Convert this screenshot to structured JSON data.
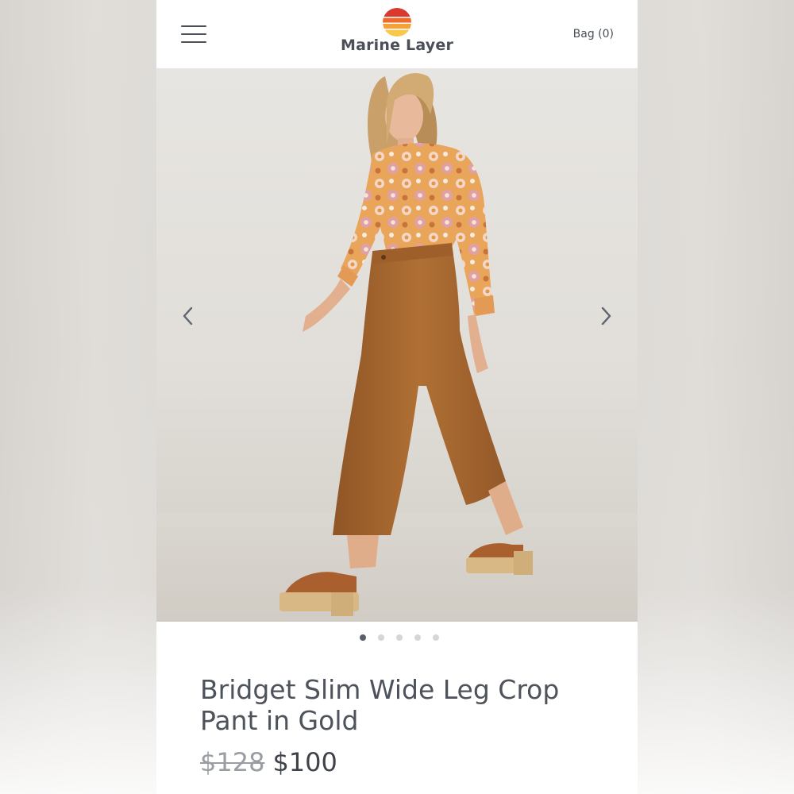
{
  "header": {
    "brand_name": "Marine Layer",
    "bag_label": "Bag (0)",
    "logo_colors": [
      "#d9392f",
      "#ef6a2b",
      "#f4a13a",
      "#f7c84a"
    ]
  },
  "icons": {
    "menu": "hamburger-menu-icon",
    "prev": "chevron-left-icon",
    "next": "chevron-right-icon"
  },
  "carousel": {
    "slide_count": 5,
    "active_index": 0
  },
  "product": {
    "title": "Bridget Slim Wide Leg Crop Pant in Gold",
    "original_price": "$128",
    "sale_price": "$100"
  },
  "colors": {
    "text_primary": "#4d525b",
    "pant_color": "#a8692f",
    "blouse_color": "#e9a55a"
  }
}
